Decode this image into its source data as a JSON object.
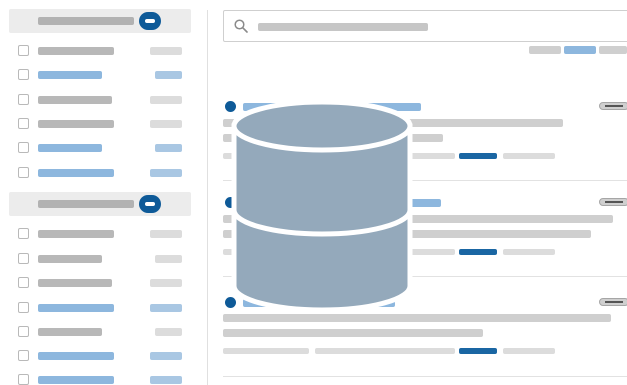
{
  "search": {
    "placeholder": "",
    "icon": "search-icon"
  },
  "pager": {
    "pages": [
      "",
      "",
      ""
    ],
    "active_index": 1
  },
  "sidebar": {
    "groups": [
      {
        "header": "",
        "items": [
          {
            "label": "",
            "count": "",
            "highlighted": false
          },
          {
            "label": "",
            "count": "",
            "highlighted": true
          },
          {
            "label": "",
            "count": "",
            "highlighted": false
          },
          {
            "label": "",
            "count": "",
            "highlighted": false
          },
          {
            "label": "",
            "count": "",
            "highlighted": true
          },
          {
            "label": "",
            "count": "",
            "highlighted": true
          }
        ]
      },
      {
        "header": "",
        "items": [
          {
            "label": "",
            "count": "",
            "highlighted": false
          },
          {
            "label": "",
            "count": "",
            "highlighted": false
          },
          {
            "label": "",
            "count": "",
            "highlighted": false
          },
          {
            "label": "",
            "count": "",
            "highlighted": true
          },
          {
            "label": "",
            "count": "",
            "highlighted": false
          },
          {
            "label": "",
            "count": "",
            "highlighted": true
          },
          {
            "label": "",
            "count": "",
            "highlighted": true
          }
        ]
      }
    ]
  },
  "results": [
    {
      "title": "",
      "snippet_1": "",
      "snippet_2": "",
      "meta": [
        "",
        "",
        "",
        ""
      ]
    },
    {
      "title": "",
      "snippet_1": "",
      "snippet_2": "",
      "meta": [
        "",
        "",
        "",
        ""
      ]
    },
    {
      "title": "",
      "snippet_1": "",
      "snippet_2": "",
      "meta": [
        "",
        "",
        "",
        ""
      ]
    }
  ],
  "overlay": {
    "icon": "database-icon",
    "color": "#94a9bb"
  },
  "colors": {
    "accent": "#0e5a98",
    "link": "#8db7de",
    "skeleton": "#cfcfcf"
  }
}
